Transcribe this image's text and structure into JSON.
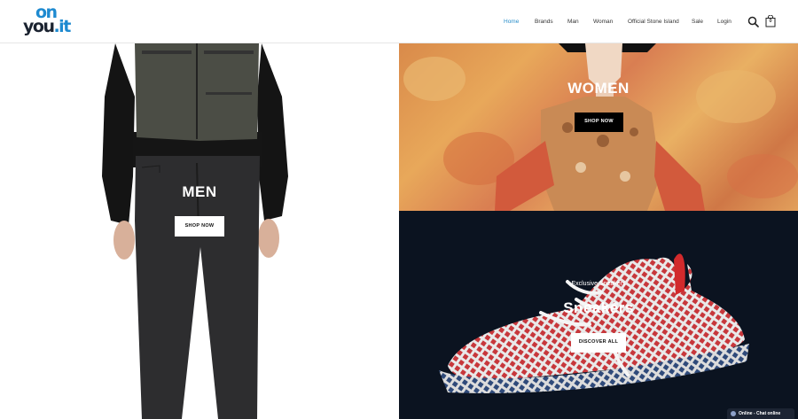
{
  "header": {
    "logo_top": "on",
    "logo_bottom": "you",
    "logo_tld": ".it",
    "nav": [
      {
        "label": "Home",
        "active": true
      },
      {
        "label": "Brands"
      },
      {
        "label": "Man",
        "dropdown": true
      },
      {
        "label": "Woman",
        "dropdown": true
      },
      {
        "label": "Official Stone Island"
      },
      {
        "label": "Sale"
      },
      {
        "label": "Login"
      }
    ],
    "cart_count": "0",
    "icons": {
      "search": "search-icon",
      "cart": "shopping-bag-icon"
    }
  },
  "hero": {
    "men": {
      "title": "MEN",
      "button": "SHOP NOW"
    },
    "women": {
      "title": "WOMEN",
      "button": "SHOP NOW"
    },
    "sneakers": {
      "subtitle": "Exclusive Sneakers",
      "title": "Sneakers",
      "button": "DISCOVER ALL"
    }
  },
  "chat": {
    "label": "Online - Chat online"
  },
  "colors": {
    "accent": "#2a8ec9",
    "logo_dark": "#1b2330",
    "dark_panel": "#0b1320"
  }
}
